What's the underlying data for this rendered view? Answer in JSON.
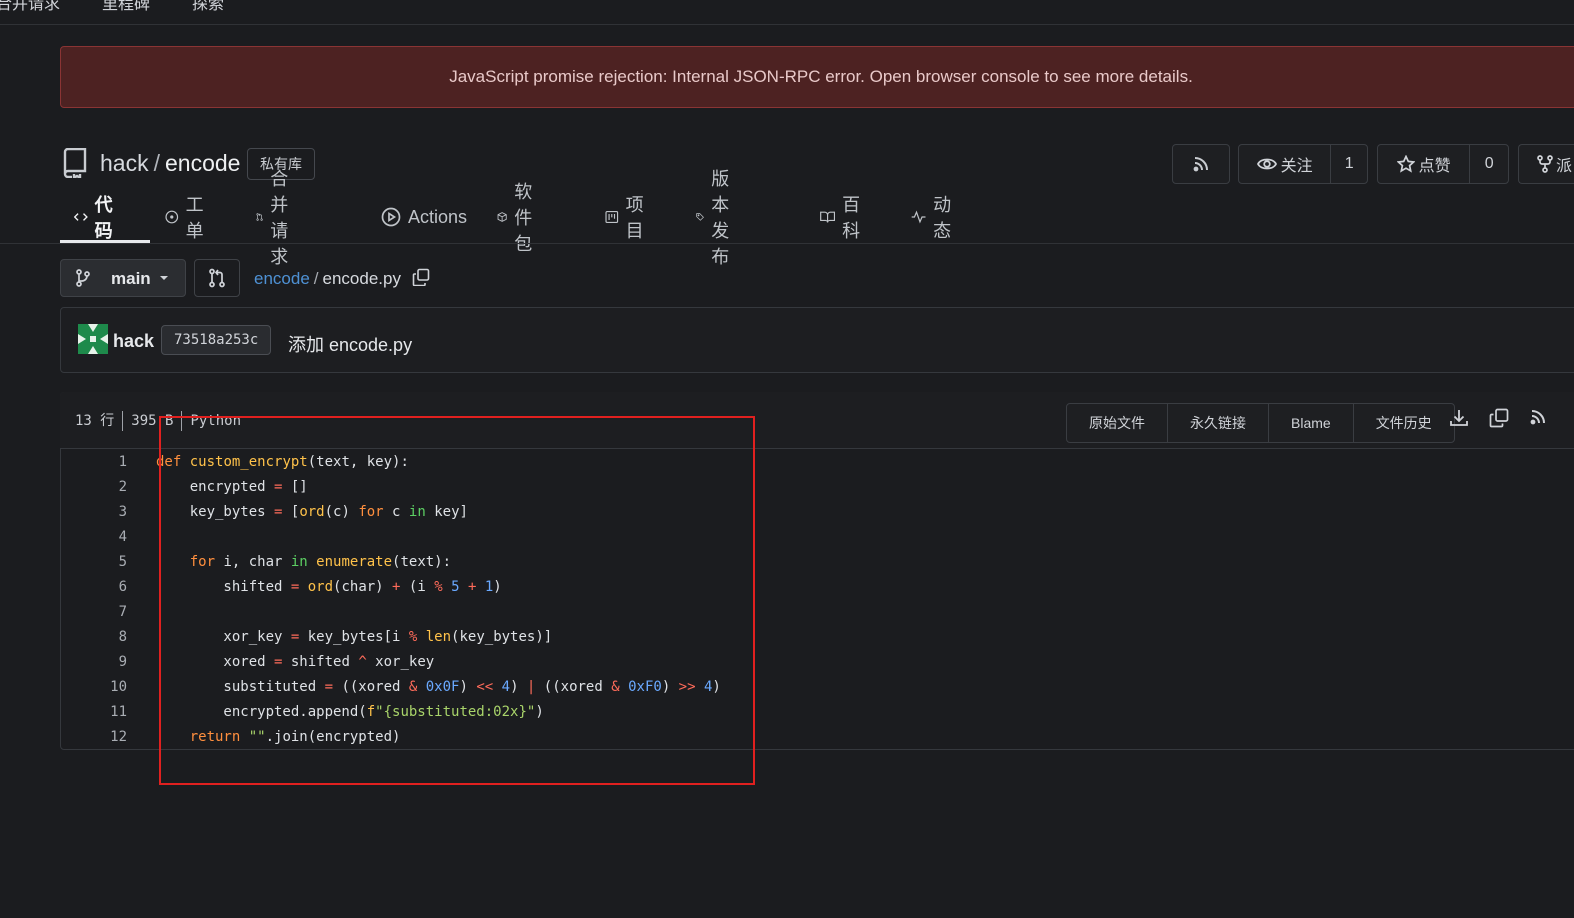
{
  "topnav": {
    "items": [
      "合并请求",
      "里程碑",
      "探索"
    ]
  },
  "error_banner": {
    "text": "JavaScript promise rejection: Internal JSON-RPC error. Open browser console to see more details."
  },
  "repo": {
    "owner": "hack",
    "separator": "/",
    "name": "encode",
    "visibility_badge": "私有库",
    "watch_label": "关注",
    "watch_count": "1",
    "star_label": "点赞",
    "star_count": "0",
    "fork_label": "派"
  },
  "tabs": [
    {
      "label": "代码",
      "icon": "code-icon"
    },
    {
      "label": "工单",
      "icon": "issue-icon"
    },
    {
      "label": "合并请求",
      "icon": "pull-request-icon"
    },
    {
      "label": "Actions",
      "icon": "play-icon"
    },
    {
      "label": "软件包",
      "icon": "package-icon"
    },
    {
      "label": "项目",
      "icon": "project-icon"
    },
    {
      "label": "版本发布",
      "icon": "tag-icon"
    },
    {
      "label": "百科",
      "icon": "book-icon"
    },
    {
      "label": "动态",
      "icon": "pulse-icon"
    }
  ],
  "branch": {
    "name": "main"
  },
  "breadcrumb": {
    "repo_link": "encode",
    "separator": "/",
    "file": "encode.py"
  },
  "commit": {
    "author": "hack",
    "sha": "73518a253c",
    "message": "添加 encode.py"
  },
  "file": {
    "lines_info": "13 行",
    "size": "395 B",
    "language": "Python",
    "actions": [
      "原始文件",
      "永久链接",
      "Blame",
      "文件历史"
    ]
  },
  "code_lines": [
    {
      "n": "1",
      "text": "def custom_encrypt(text, key):"
    },
    {
      "n": "2",
      "text": "    encrypted = []"
    },
    {
      "n": "3",
      "text": "    key_bytes = [ord(c) for c in key]"
    },
    {
      "n": "4",
      "text": ""
    },
    {
      "n": "5",
      "text": "    for i, char in enumerate(text):"
    },
    {
      "n": "6",
      "text": "        shifted = ord(char) + (i % 5 + 1)"
    },
    {
      "n": "7",
      "text": ""
    },
    {
      "n": "8",
      "text": "        xor_key = key_bytes[i % len(key_bytes)]"
    },
    {
      "n": "9",
      "text": "        xored = shifted ^ xor_key"
    },
    {
      "n": "10",
      "text": "        substituted = ((xored & 0x0F) << 4) | ((xored & 0xF0) >> 4)"
    },
    {
      "n": "11",
      "text": "        encrypted.append(f\"{substituted:02x}\")"
    },
    {
      "n": "12",
      "text": "    return \"\".join(encrypted)"
    }
  ],
  "colors": {
    "background": "#1b1c1f",
    "banner_bg": "#4d2222",
    "link": "#4e91d4",
    "keyword": "#ff8f3e",
    "function": "#ffc24a",
    "number": "#6aa9ff",
    "highlight_box": "#e0201f"
  }
}
